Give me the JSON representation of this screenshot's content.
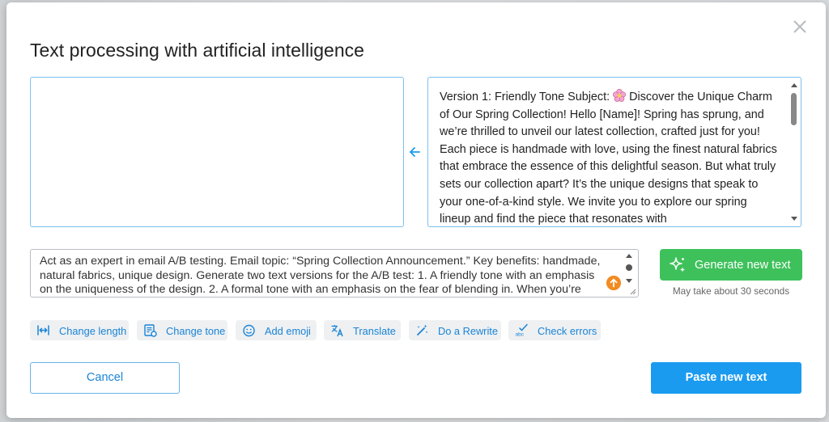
{
  "dialog": {
    "title": "Text processing with artificial intelligence",
    "result_text": "Version 1: Friendly Tone Subject:",
    "result_text_rest": " Discover the Unique Charm of Our Spring Collection! Hello [Name]! Spring has sprung, and we’re thrilled to unveil our latest collection, crafted just for you! Each piece is handmade with love, using the finest natural fabrics that embrace the essence of this delightful season. But what truly sets our collection apart? It’s the unique designs that speak to your one-of-a-kind style. We invite you to explore our spring lineup and find the piece that resonates with",
    "source_text": "",
    "prompt_text": "Act as an expert in email A/B testing. Email topic: “Spring Collection Announcement.” Key benefits: handmade, natural fabrics, unique design. Generate two text versions for the A/B test: 1. A friendly tone with an emphasis on the uniqueness of the design. 2. A formal tone with an emphasis on the fear of blending in. When you’re done,",
    "generate_label": "Generate new text",
    "generate_note": "May take about 30 seconds",
    "tools": [
      {
        "label": "Change length",
        "icon": "change-length-icon"
      },
      {
        "label": "Change tone",
        "icon": "change-tone-icon"
      },
      {
        "label": "Add emoji",
        "icon": "emoji-icon"
      },
      {
        "label": "Translate",
        "icon": "translate-icon"
      },
      {
        "label": "Do a Rewrite",
        "icon": "rewrite-icon"
      },
      {
        "label": "Check errors",
        "icon": "spellcheck-icon"
      }
    ],
    "cancel_label": "Cancel",
    "paste_label": "Paste new text"
  },
  "colors": {
    "accent": "#1a9bf0",
    "generate": "#3ec15b",
    "tool_text": "#1a84d6",
    "send_icon": "#f28b22"
  }
}
